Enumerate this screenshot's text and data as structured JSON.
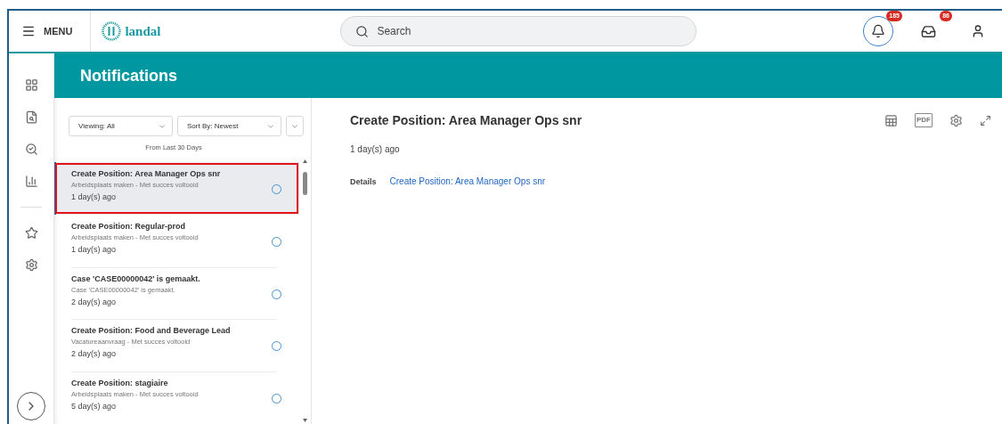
{
  "header": {
    "menu_label": "MENU",
    "logo_text": "landal",
    "search_placeholder": "Search",
    "notification_count": "185",
    "inbox_count": "86"
  },
  "page_title": "Notifications",
  "filters": {
    "viewing": "Viewing: All",
    "sort": "Sort By: Newest",
    "range": "From Last 30 Days"
  },
  "notifications": [
    {
      "title": "Create Position: Area Manager Ops snr",
      "subtitle": "Arbeidsplaats maken - Met succes voltooid",
      "time": "1 day(s) ago",
      "selected": true
    },
    {
      "title": "Create Position: Regular-prod",
      "subtitle": "Arbeidsplaats maken - Met succes voltooid",
      "time": "1 day(s) ago",
      "selected": false
    },
    {
      "title": "Case 'CASE00000042' is gemaakt.",
      "subtitle": "Case 'CASE00000042' is gemaakt.",
      "time": "2 day(s) ago",
      "selected": false
    },
    {
      "title": "Create Position: Food and Beverage Lead",
      "subtitle": "Vacatureaanvraag - Met succes voltooid",
      "time": "2 day(s) ago",
      "selected": false
    },
    {
      "title": "Create Position: stagiaire",
      "subtitle": "Arbeidsplaats maken - Met succes voltooid",
      "time": "5 day(s) ago",
      "selected": false
    }
  ],
  "detail": {
    "title": "Create Position: Area Manager Ops snr",
    "time": "1 day(s) ago",
    "details_label": "Details",
    "details_link": "Create Position: Area Manager Ops snr",
    "pdf_label": "PDF"
  }
}
